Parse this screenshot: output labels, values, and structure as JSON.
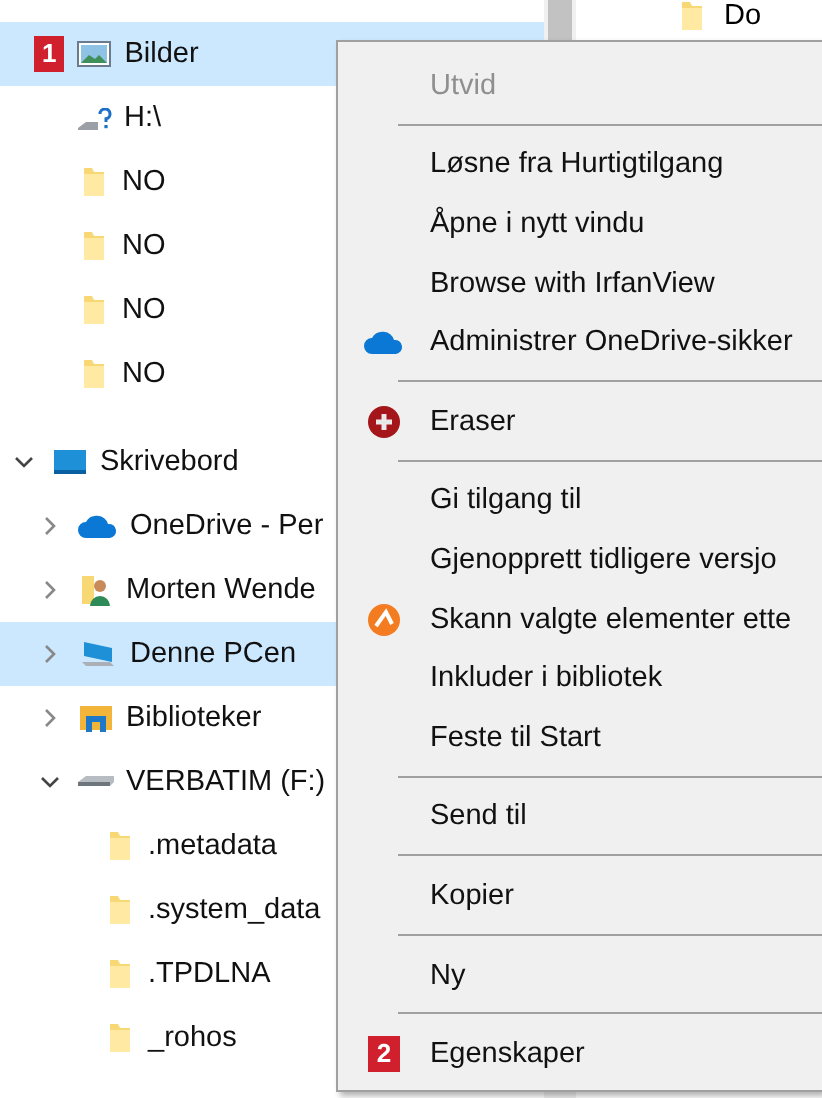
{
  "quick_access": [
    {
      "label": "Bilder",
      "kind": "picture",
      "badge": "1",
      "selected": true
    },
    {
      "label": "H:\\",
      "kind": "unknown-drive",
      "selected": false
    },
    {
      "label": "NO",
      "kind": "folder",
      "selected": false
    },
    {
      "label": "NO",
      "kind": "folder",
      "selected": false
    },
    {
      "label": "NO",
      "kind": "folder",
      "selected": false
    },
    {
      "label": "NO",
      "kind": "folder",
      "selected": false
    }
  ],
  "tree": [
    {
      "label": "Skrivebord",
      "kind": "desktop",
      "expanded": true,
      "selected": false,
      "children": [
        {
          "label": "OneDrive - Per",
          "kind": "cloud",
          "expanded": false,
          "selected": false
        },
        {
          "label": "Morten Wende",
          "kind": "user",
          "expanded": false,
          "selected": false
        },
        {
          "label": "Denne PCen",
          "kind": "pc",
          "expanded": false,
          "selected": true
        },
        {
          "label": "Biblioteker",
          "kind": "library",
          "expanded": false,
          "selected": false
        },
        {
          "label": "VERBATIM (F:)",
          "kind": "drive",
          "expanded": true,
          "selected": false,
          "children": [
            {
              "label": ".metadata",
              "kind": "folder",
              "selected": false
            },
            {
              "label": ".system_data",
              "kind": "folder",
              "selected": false
            },
            {
              "label": ".TPDLNA",
              "kind": "folder",
              "selected": false
            },
            {
              "label": "_rohos",
              "kind": "folder",
              "selected": false
            }
          ]
        }
      ]
    }
  ],
  "file_pane": {
    "items": [
      {
        "label": "Do"
      }
    ]
  },
  "context_menu": {
    "items": [
      {
        "kind": "plain",
        "label": "Utvid",
        "disabled": true
      },
      {
        "kind": "separator"
      },
      {
        "kind": "plain",
        "label": "Løsne fra Hurtigtilgang",
        "disabled": false
      },
      {
        "kind": "plain",
        "label": "Åpne i nytt vindu",
        "disabled": false
      },
      {
        "kind": "plain",
        "label": "Browse with IrfanView",
        "disabled": false
      },
      {
        "kind": "cloud",
        "label": "Administrer OneDrive-sikker",
        "disabled": false
      },
      {
        "kind": "separator"
      },
      {
        "kind": "eraser",
        "label": "Eraser",
        "disabled": false
      },
      {
        "kind": "separator"
      },
      {
        "kind": "plain",
        "label": "Gi tilgang til",
        "disabled": false
      },
      {
        "kind": "plain",
        "label": "Gjenopprett tidligere versjo",
        "disabled": false
      },
      {
        "kind": "antivirus",
        "label": "Skann valgte elementer ette",
        "disabled": false
      },
      {
        "kind": "plain",
        "label": "Inkluder i bibliotek",
        "disabled": false
      },
      {
        "kind": "plain",
        "label": "Feste til Start",
        "disabled": false
      },
      {
        "kind": "separator"
      },
      {
        "kind": "plain",
        "label": "Send til",
        "disabled": false
      },
      {
        "kind": "separator"
      },
      {
        "kind": "plain",
        "label": "Kopier",
        "disabled": false
      },
      {
        "kind": "separator"
      },
      {
        "kind": "plain",
        "label": "Ny",
        "disabled": false
      },
      {
        "kind": "separator"
      },
      {
        "kind": "plain",
        "label": "Egenskaper",
        "badge": "2",
        "disabled": false
      }
    ]
  }
}
